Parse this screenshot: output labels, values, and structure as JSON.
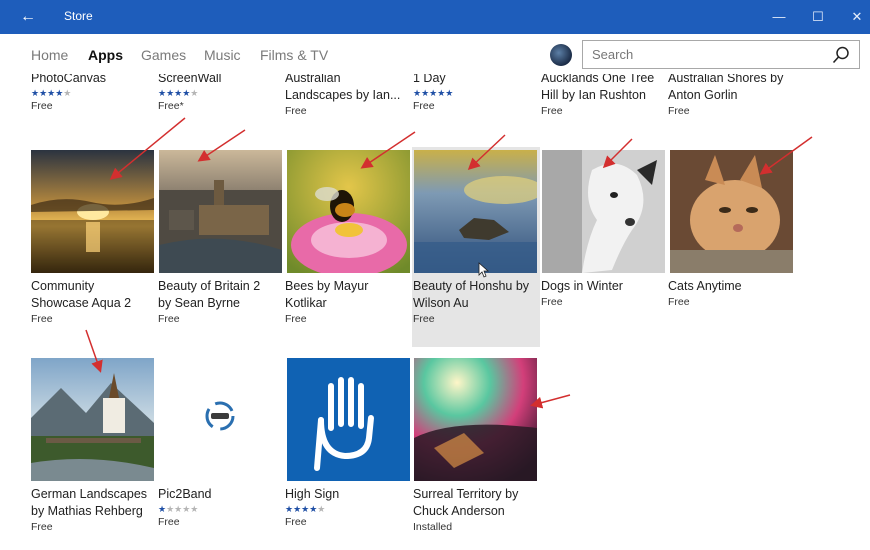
{
  "window": {
    "title": "Store",
    "back_icon": "←",
    "minimize": "—",
    "maximize": "☐",
    "close": "✕"
  },
  "nav": {
    "tabs": [
      "Home",
      "Apps",
      "Games",
      "Music",
      "Films & TV"
    ],
    "active": "Apps"
  },
  "search": {
    "placeholder": "Search",
    "value": ""
  },
  "top_row": [
    {
      "name": "PhotoCanvas",
      "stars": 4,
      "price": "Free"
    },
    {
      "name": "ScreenWall",
      "stars": 4,
      "price": "Free*"
    },
    {
      "name_l1": "Australian",
      "name_l2": "Landscapes by Ian...",
      "price": "Free"
    },
    {
      "name": "1 Day",
      "stars": 5,
      "price": "Free"
    },
    {
      "name_l1": "Aucklands One Tree",
      "name_l2": "Hill by Ian Rushton",
      "price": "Free"
    },
    {
      "name_l1": "Australian Shores by",
      "name_l2": "Anton Gorlin",
      "price": "Free"
    }
  ],
  "row2": [
    {
      "name_l1": "Community",
      "name_l2": "Showcase Aqua 2",
      "price": "Free"
    },
    {
      "name_l1": "Beauty of Britain 2",
      "name_l2": "by Sean Byrne",
      "price": "Free"
    },
    {
      "name_l1": "Bees by Mayur",
      "name_l2": "Kotlikar",
      "price": "Free"
    },
    {
      "name_l1": "Beauty of Honshu by",
      "name_l2": "Wilson Au",
      "price": "Free"
    },
    {
      "name_l1": "Dogs in Winter",
      "price": "Free"
    },
    {
      "name_l1": "Cats Anytime",
      "price": "Free"
    }
  ],
  "row3": [
    {
      "name_l1": "German Landscapes",
      "name_l2": "by Mathias Rehberg",
      "price": "Free"
    },
    {
      "name_l1": "Pic2Band",
      "stars": 1,
      "price": "Free"
    },
    {
      "name_l1": "High Sign",
      "stars": 4,
      "price": "Free"
    },
    {
      "name_l1": "Surreal Territory by",
      "name_l2": "Chuck Anderson",
      "price": "Installed"
    }
  ],
  "colors": {
    "titlebar": "#1e5dbb",
    "star": "#1f4fa5",
    "arrow": "#d32f2f"
  }
}
